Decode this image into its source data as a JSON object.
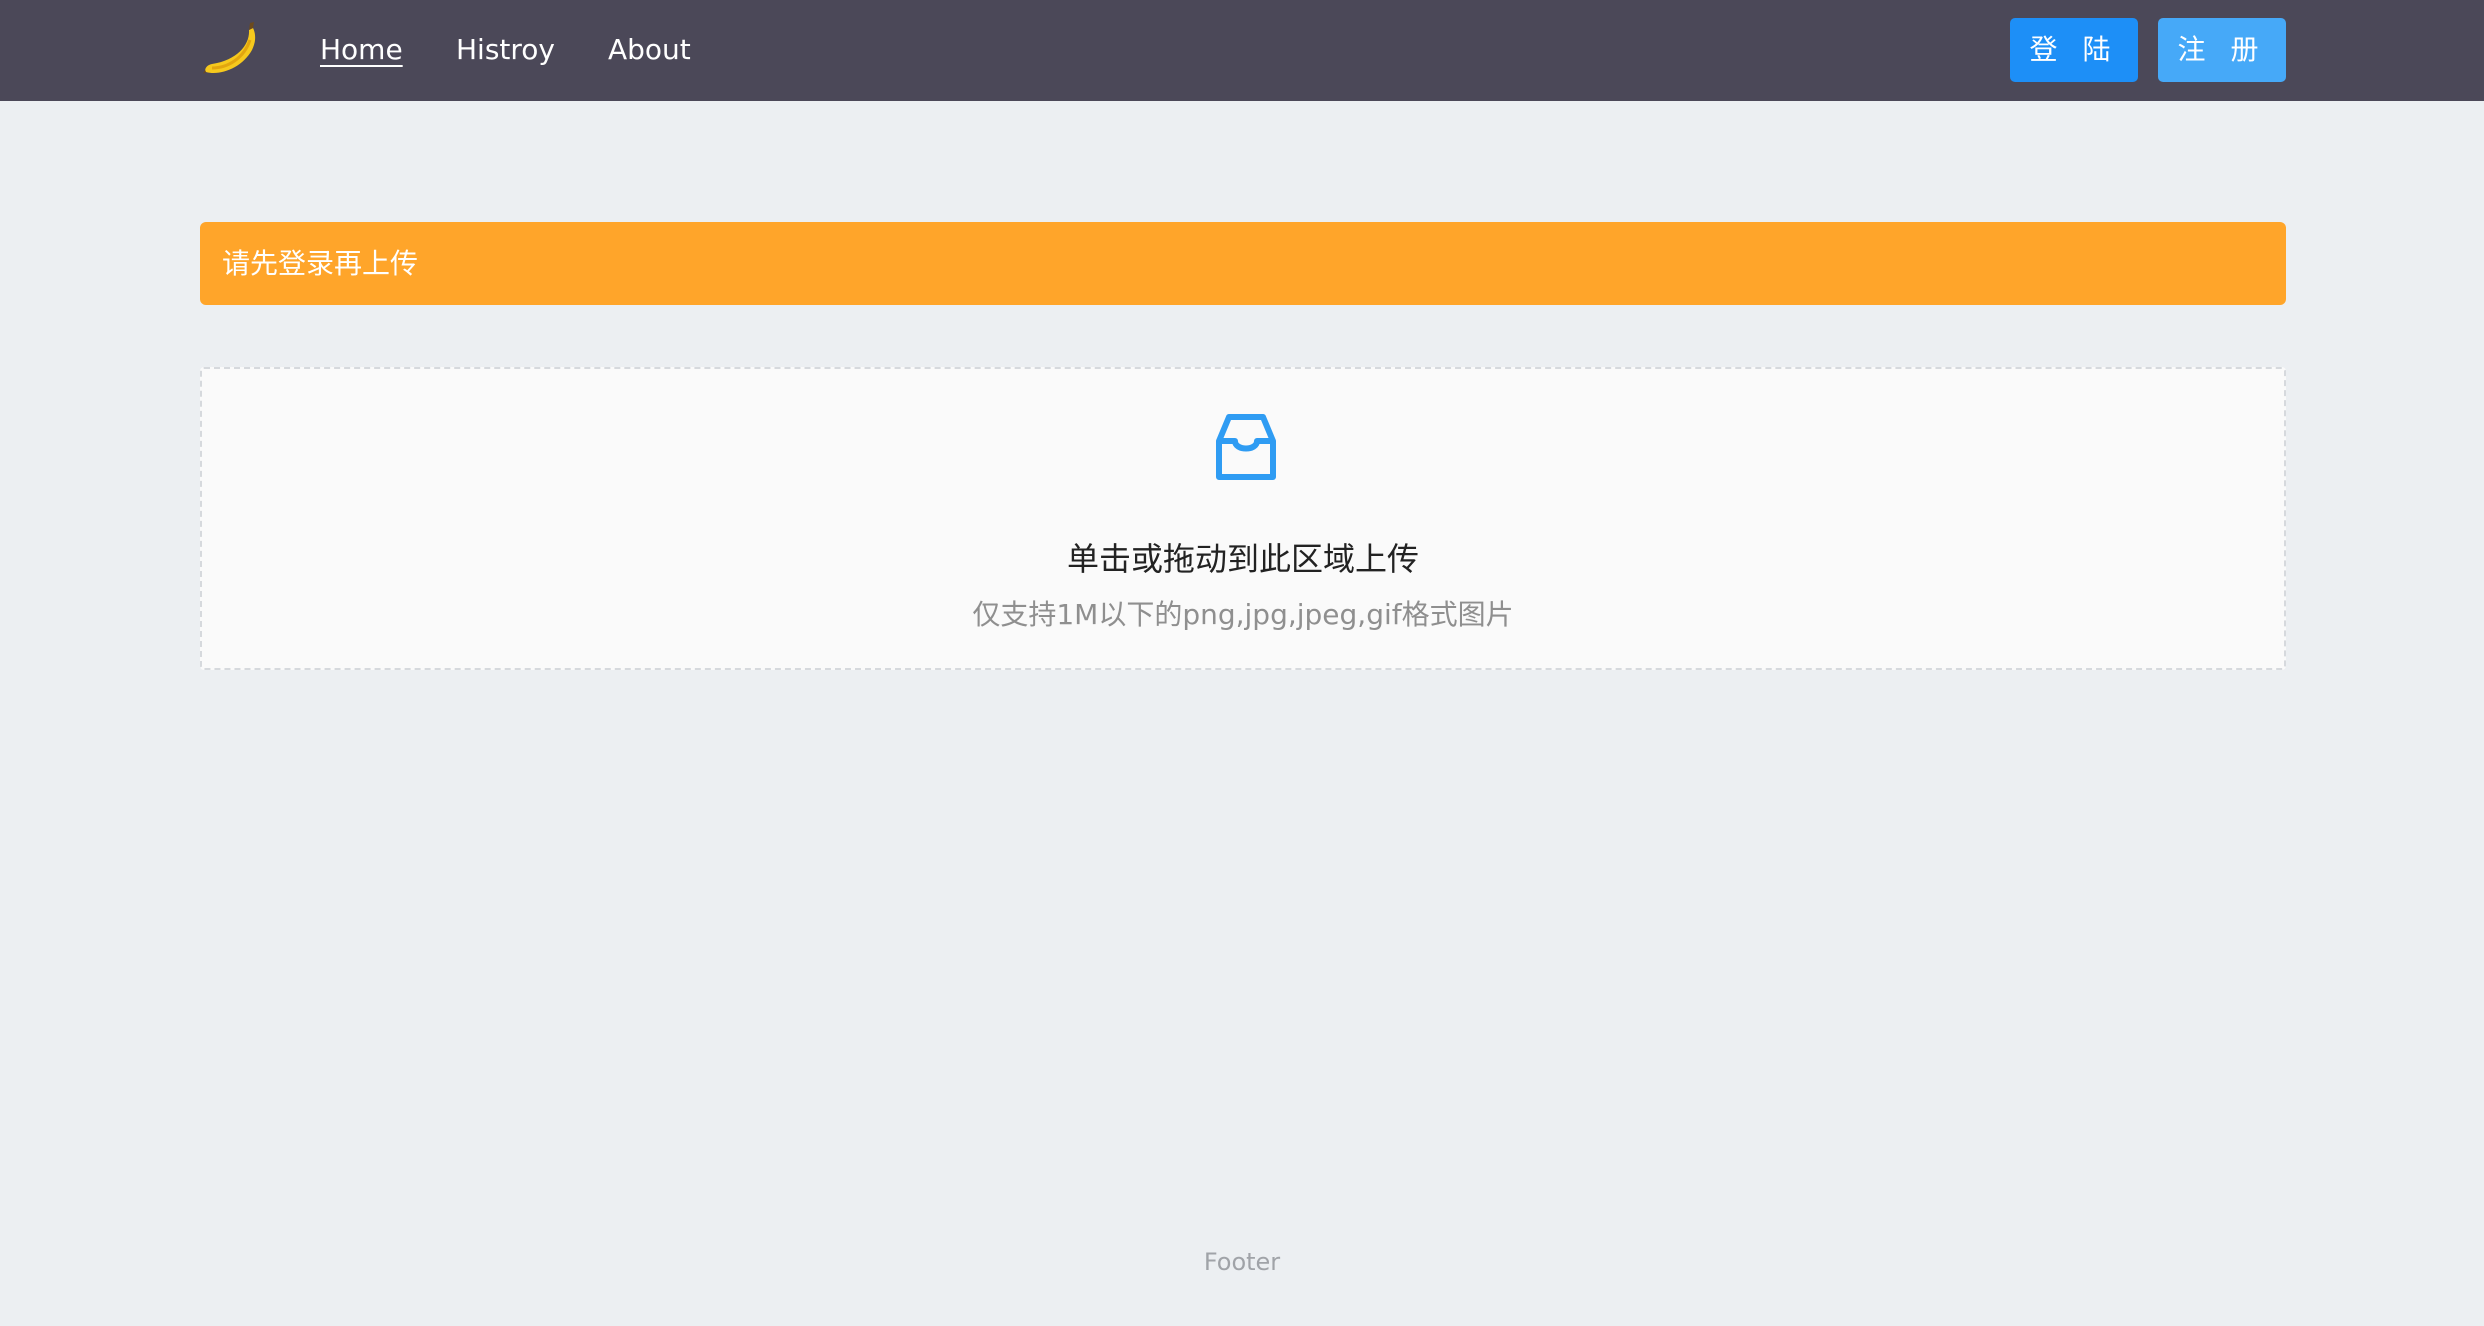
{
  "header": {
    "logo_icon": "banana-icon",
    "nav": {
      "home": "Home",
      "history": "Histroy",
      "about": "About"
    },
    "login_label": "登 陆",
    "register_label": "注 册"
  },
  "alert": {
    "message": "请先登录再上传",
    "color": "#ffa52a"
  },
  "upload": {
    "icon": "inbox-icon",
    "title": "单击或拖动到此区域上传",
    "hint": "仅支持1M以下的png,jpg,jpeg,gif格式图片",
    "accent": "#2f9cf3"
  },
  "footer": {
    "text": "Footer"
  },
  "colors": {
    "header_bg": "#4b4858",
    "page_bg": "#eceff2",
    "login_button": "#1d8ff7",
    "register_button": "#46a9f8"
  }
}
